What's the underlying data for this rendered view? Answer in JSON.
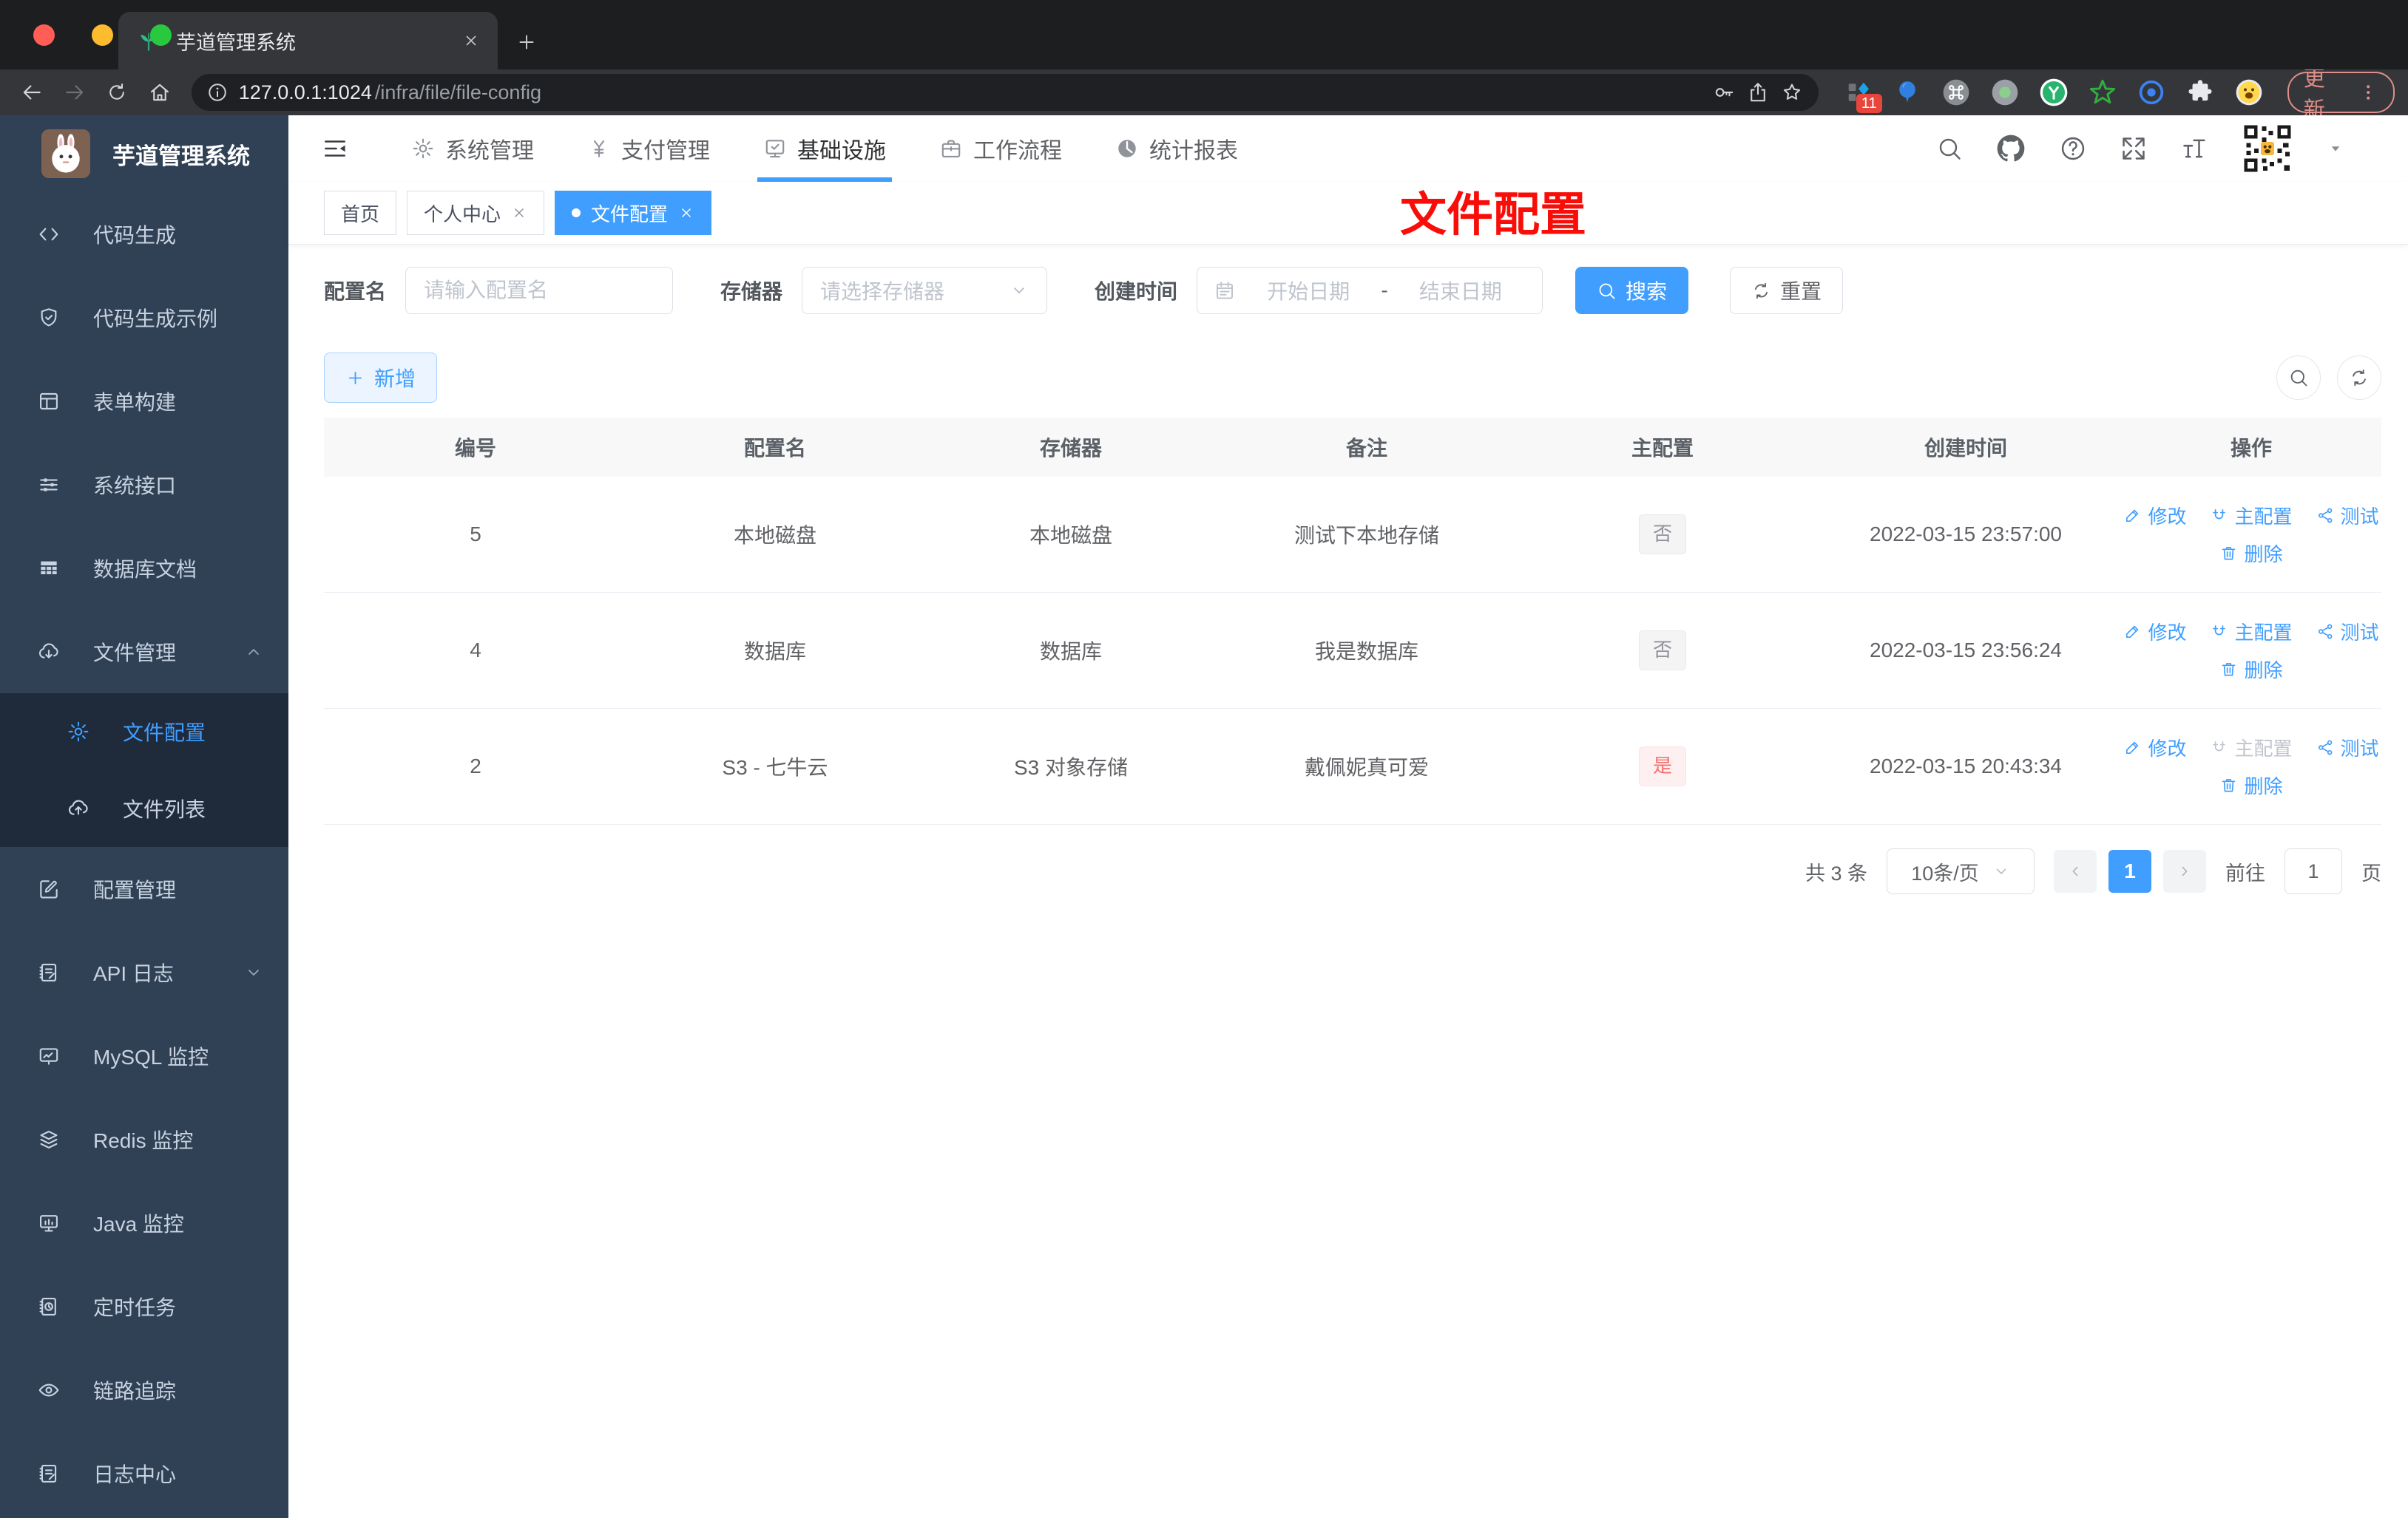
{
  "colors": {
    "accent": "#409eff",
    "danger": "#f56c6c",
    "tab_active_bg": "#409eff",
    "annotation_red": "#f90d09"
  },
  "browser": {
    "tab_title": "芋道管理系统",
    "url_host": "127.0.0.1:1024",
    "url_path": "/infra/file/file-config",
    "ext_badge": "11",
    "update_label": "更新"
  },
  "sidebar": {
    "title": "芋道管理系统",
    "items": [
      {
        "icon": "code-icon",
        "label": "代码生成"
      },
      {
        "icon": "shield-check-icon",
        "label": "代码生成示例"
      },
      {
        "icon": "form-icon",
        "label": "表单构建"
      },
      {
        "icon": "sliders-icon",
        "label": "系统接口"
      },
      {
        "icon": "database-doc-icon",
        "label": "数据库文档"
      },
      {
        "icon": "cloud-download-icon",
        "label": "文件管理",
        "expanded": true,
        "children": [
          {
            "icon": "gear-icon",
            "label": "文件配置",
            "active": true
          },
          {
            "icon": "cloud-upload-icon",
            "label": "文件列表"
          }
        ]
      },
      {
        "icon": "edit-square-icon",
        "label": "配置管理"
      },
      {
        "icon": "api-log-icon",
        "label": "API 日志"
      },
      {
        "icon": "mysql-monitor-icon",
        "label": "MySQL 监控"
      },
      {
        "icon": "redis-icon",
        "label": "Redis 监控"
      },
      {
        "icon": "java-monitor-icon",
        "label": "Java 监控"
      },
      {
        "icon": "timer-icon",
        "label": "定时任务"
      },
      {
        "icon": "eye-icon",
        "label": "链路追踪"
      },
      {
        "icon": "log-center-icon",
        "label": "日志中心"
      }
    ]
  },
  "topnav": {
    "items": [
      {
        "icon": "gear-icon",
        "label": "系统管理"
      },
      {
        "icon": "yen-icon",
        "label": "支付管理"
      },
      {
        "icon": "infra-icon",
        "label": "基础设施",
        "active": true
      },
      {
        "icon": "briefcase-icon",
        "label": "工作流程"
      },
      {
        "icon": "chart-icon",
        "label": "统计报表"
      }
    ]
  },
  "tabs": [
    {
      "label": "首页"
    },
    {
      "label": "个人中心",
      "closable": true
    },
    {
      "label": "文件配置",
      "closable": true,
      "active": true
    }
  ],
  "annotation": "文件配置",
  "filters": {
    "name": {
      "label": "配置名",
      "placeholder": "请输入配置名"
    },
    "storage": {
      "label": "存储器",
      "placeholder": "请选择存储器"
    },
    "date": {
      "label": "创建时间",
      "start_placeholder": "开始日期",
      "separator": "-",
      "end_placeholder": "结束日期"
    },
    "search_label": "搜索",
    "reset_label": "重置"
  },
  "toolbar": {
    "add_label": "新增"
  },
  "table": {
    "columns": [
      "编号",
      "配置名",
      "存储器",
      "备注",
      "主配置",
      "创建时间",
      "操作"
    ],
    "actions": {
      "edit": "修改",
      "master": "主配置",
      "test": "测试",
      "delete": "删除"
    },
    "rows": [
      {
        "id": "5",
        "name": "本地磁盘",
        "storage": "本地磁盘",
        "remark": "测试下本地存储",
        "master": "否",
        "created": "2022-03-15 23:57:00"
      },
      {
        "id": "4",
        "name": "数据库",
        "storage": "数据库",
        "remark": "我是数据库",
        "master": "否",
        "created": "2022-03-15 23:56:24"
      },
      {
        "id": "2",
        "name": "S3 - 七牛云",
        "storage": "S3 对象存储",
        "remark": "戴佩妮真可爱",
        "master": "是",
        "created": "2022-03-15 20:43:34"
      }
    ]
  },
  "pagination": {
    "total": "共 3 条",
    "page_size": "10条/页",
    "page": "1",
    "goto_label": "前往",
    "goto_value": "1",
    "unit_label": "页"
  }
}
